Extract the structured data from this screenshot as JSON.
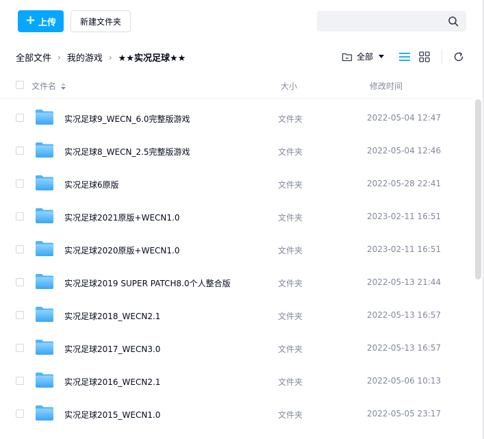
{
  "toolbar": {
    "upload_label": "上传",
    "new_folder_label": "新建文件夹",
    "search_placeholder": ""
  },
  "breadcrumb": {
    "items": [
      "全部文件",
      "我的游戏"
    ],
    "current": "★★实况足球★★"
  },
  "filter": {
    "label": "全部"
  },
  "table": {
    "headers": {
      "name": "文件名",
      "size": "大小",
      "time": "修改时间"
    },
    "rows": [
      {
        "name": "实况足球9_WECN_6.0完整版游戏",
        "size": "文件夹",
        "time": "2022-05-04 12:47"
      },
      {
        "name": "实况足球8_WECN_2.5完整版游戏",
        "size": "文件夹",
        "time": "2022-05-04 12:46"
      },
      {
        "name": "实况足球6原版",
        "size": "文件夹",
        "time": "2022-05-28 22:41"
      },
      {
        "name": "实况足球2021原版+WECN1.0",
        "size": "文件夹",
        "time": "2023-02-11 16:51"
      },
      {
        "name": "实况足球2020原版+WECN1.0",
        "size": "文件夹",
        "time": "2023-02-11 16:51"
      },
      {
        "name": "实况足球2019 SUPER PATCH8.0个人整合版",
        "size": "文件夹",
        "time": "2022-05-13 21:44"
      },
      {
        "name": "实况足球2018_WECN2.1",
        "size": "文件夹",
        "time": "2022-05-13 16:57"
      },
      {
        "name": "实况足球2017_WECN3.0",
        "size": "文件夹",
        "time": "2022-05-13 16:57"
      },
      {
        "name": "实况足球2016_WECN2.1",
        "size": "文件夹",
        "time": "2022-05-06 10:13"
      },
      {
        "name": "实况足球2015_WECN1.0",
        "size": "文件夹",
        "time": "2022-05-05 23:17"
      }
    ]
  },
  "colors": {
    "accent": "#06a7ff",
    "folder_light": "#8fd4ff",
    "folder_dark": "#3aa6f5",
    "muted_text": "#818999"
  },
  "icons": [
    "plus-icon",
    "search-icon",
    "folder-filter-icon",
    "list-view-icon",
    "grid-view-icon",
    "refresh-icon",
    "sort-icon",
    "folder-icon"
  ]
}
